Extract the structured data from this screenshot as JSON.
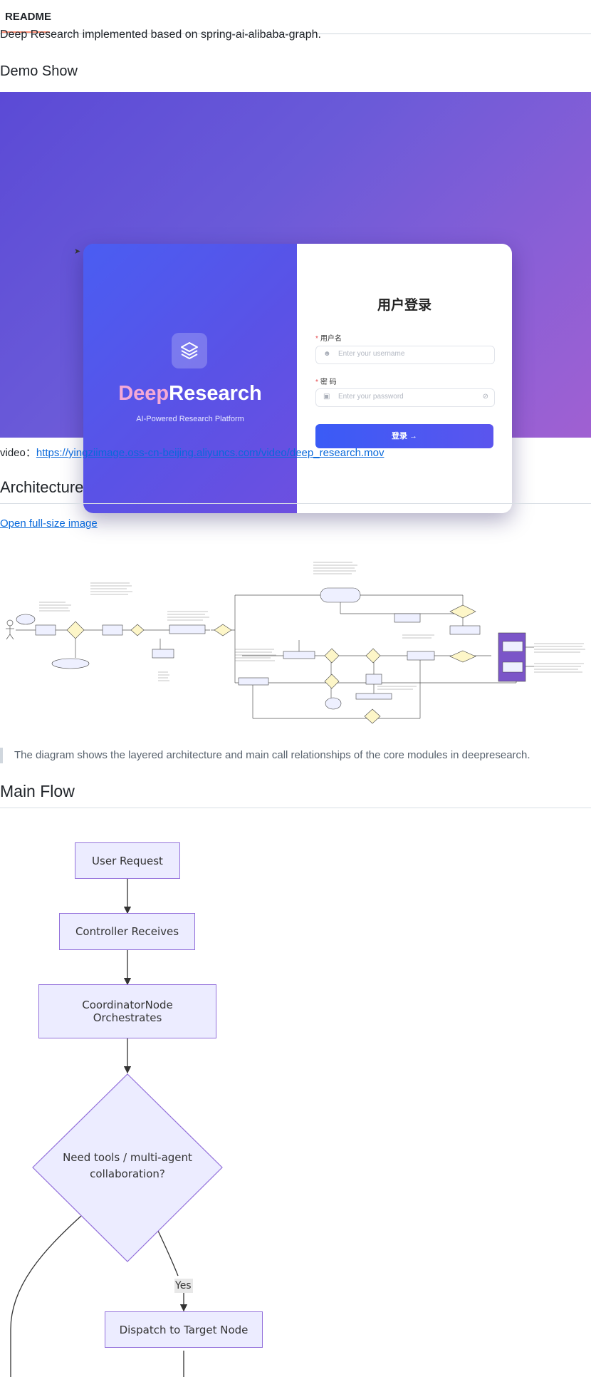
{
  "tabs": {
    "readme": "README"
  },
  "intro": "Deep Research implemented based on spring-ai-alibaba-graph.",
  "demo": {
    "heading": "Demo Show",
    "brand_part1": "Deep",
    "brand_part2": "Research",
    "tagline": "AI-Powered Research Platform",
    "login_title": "用户登录",
    "username_label": "用户名",
    "username_placeholder": "Enter your username",
    "password_label": "密 码",
    "password_placeholder": "Enter your password",
    "login_button": "登录 →"
  },
  "video": {
    "prefix": "video：",
    "url": "https://yingziimage.oss-cn-beijing.aliyuncs.com/video/deep_research.mov"
  },
  "architecture": {
    "heading": "Architecture",
    "open_link": "Open full-size image",
    "caption": "The diagram shows the layered architecture and main call relationships of the core modules in deepresearch."
  },
  "main_flow": {
    "heading": "Main Flow",
    "nodes": {
      "user_request": "User Request",
      "controller": "Controller Receives",
      "coordinator_line1": "CoordinatorNode",
      "coordinator_line2": "Orchestrates",
      "decision_line1": "Need tools / multi-agent",
      "decision_line2": "collaboration?",
      "dispatch": "Dispatch to Target Node"
    },
    "edge_yes": "Yes"
  },
  "colors": {
    "link": "#0969da",
    "flow_node_fill": "#ececff",
    "flow_node_border": "#9370db",
    "demo_gradient_start": "#5b4ad6",
    "demo_gradient_end": "#a060d2",
    "tab_underline": "#fd8c73"
  }
}
